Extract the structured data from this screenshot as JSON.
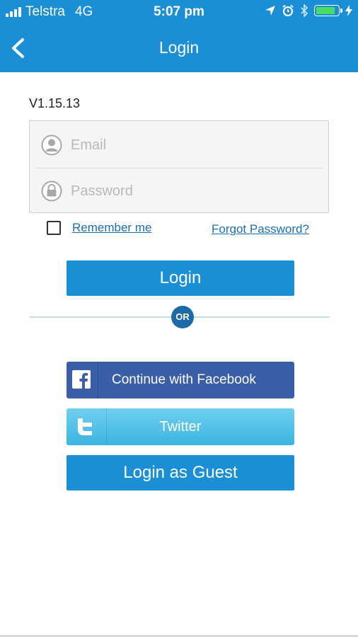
{
  "status_bar": {
    "carrier": "Telstra",
    "network": "4G",
    "time": "5:07 pm",
    "battery_level": 0.85,
    "battery_color": "#4cd964"
  },
  "nav": {
    "title": "Login",
    "back_icon": "chevron-left-icon"
  },
  "version": "V1.15.13",
  "form": {
    "email": {
      "value": "",
      "placeholder": "Email",
      "icon": "user-icon"
    },
    "password": {
      "value": "",
      "placeholder": "Password",
      "icon": "lock-icon"
    }
  },
  "remember_me": {
    "label": "Remember me",
    "checked": false
  },
  "forgot_password": {
    "label": "Forgot Password?"
  },
  "login_button": {
    "label": "Login"
  },
  "divider": {
    "label": "OR"
  },
  "facebook_button": {
    "label": "Continue with Facebook",
    "icon": "facebook-icon"
  },
  "twitter_button": {
    "label": "Twitter",
    "icon": "twitter-icon"
  },
  "guest_button": {
    "label": "Login as Guest"
  },
  "colors": {
    "primary": "#1a8fd6",
    "facebook": "#3b5ea8",
    "twitter": "#4ec0e8",
    "link": "#1a6fb0",
    "or_badge": "#1d6aa8"
  }
}
